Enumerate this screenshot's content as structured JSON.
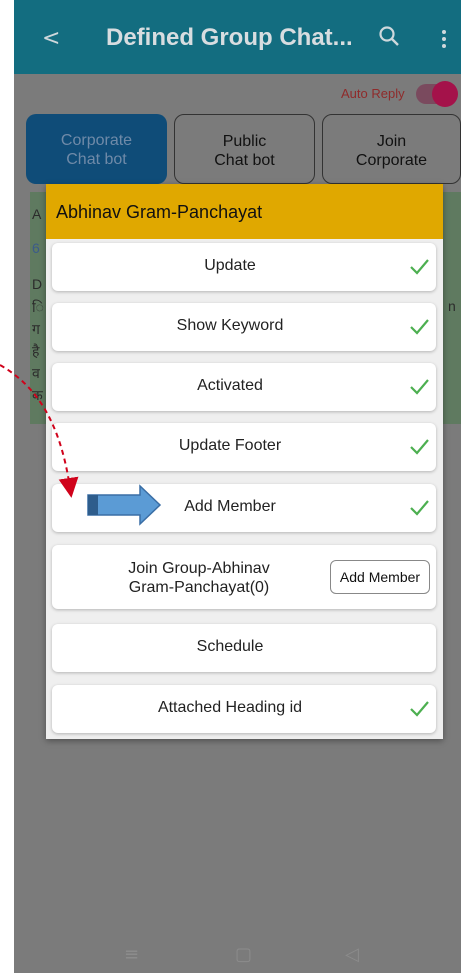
{
  "appbar": {
    "back_icon": "chevron-left-icon",
    "title": "Defined Group Chat...",
    "search_icon": "search-icon",
    "menu_icon": "more-vert-icon"
  },
  "auto_reply": {
    "label": "Auto Reply",
    "enabled": true
  },
  "tabs": [
    {
      "line1": "Corporate",
      "line2": "Chat bot"
    },
    {
      "line1": "Public",
      "line2": "Chat bot"
    },
    {
      "line1": "Join",
      "line2": "Corporate"
    }
  ],
  "background_card": {
    "fragments": [
      "A",
      "6",
      "D",
      "ि",
      "ग",
      "है",
      "व",
      "क",
      "n"
    ]
  },
  "dialog": {
    "title": "Abhinav Gram-Panchayat",
    "items": [
      {
        "label": "Update",
        "checked": true
      },
      {
        "label": "Show Keyword",
        "checked": true
      },
      {
        "label": "Activated",
        "checked": true
      },
      {
        "label": "Update Footer",
        "checked": true
      },
      {
        "label": "Add Member",
        "checked": true
      },
      {
        "label_line1": "Join Group-Abhinav",
        "label_line2": "Gram-Panchayat(0)",
        "button": "Add Member"
      },
      {
        "label": "Schedule",
        "checked": false
      },
      {
        "label": "Attached Heading id",
        "checked": true
      }
    ]
  },
  "navbar": {
    "menu_icon": "≡",
    "home_icon": "▢",
    "back_icon": "◁"
  },
  "colors": {
    "appbar": "#136d80",
    "dialog_header": "#e0a800",
    "check": "#4caf50",
    "annotation_arrow": "#d0021b",
    "callout_arrow": "#5b9bd5"
  }
}
